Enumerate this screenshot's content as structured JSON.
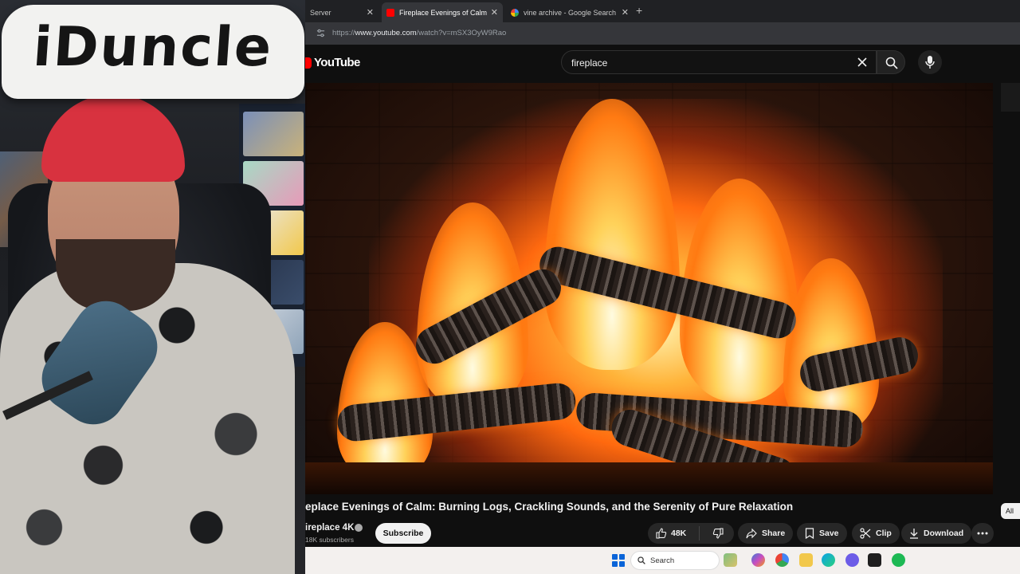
{
  "webcam": {
    "sign_text": "iDuncle"
  },
  "browser": {
    "tabs": [
      {
        "title": "Server",
        "active": false
      },
      {
        "title": "Fireplace Evenings of Calm",
        "active": true
      },
      {
        "title": "vine archive - Google Search",
        "active": false
      }
    ],
    "new_tab_symbol": "+",
    "url_prefix": "https://",
    "url_host": "www.youtube.com",
    "url_path": "/watch?v=mSX3OyW9Rao"
  },
  "youtube": {
    "logo_text": "YouTube",
    "search_query": "fireplace",
    "video_title": "eplace Evenings of Calm: Burning Logs, Crackling Sounds, and the Serenity of Pure Relaxation",
    "channel_name": "ireplace 4K",
    "subscribers": "18K subscribers",
    "subscribe_label": "Subscribe",
    "likes": "48K",
    "share_label": "Share",
    "save_label": "Save",
    "clip_label": "Clip",
    "download_label": "Download",
    "chip_all": "All"
  },
  "taskbar": {
    "search_placeholder": "Search"
  },
  "colors": {
    "yt_red": "#ff0000",
    "yt_bg": "#0f0f0f",
    "pill_bg": "#272727",
    "windows_blue": "#0a64d8"
  },
  "icons": [
    "tune-icon",
    "tab-close-icon",
    "youtube-logo-icon",
    "clear-icon",
    "search-icon",
    "mic-icon",
    "thumbs-up-icon",
    "thumbs-down-icon",
    "share-icon",
    "save-icon",
    "clip-icon",
    "download-icon",
    "more-icon",
    "windows-start-icon"
  ]
}
